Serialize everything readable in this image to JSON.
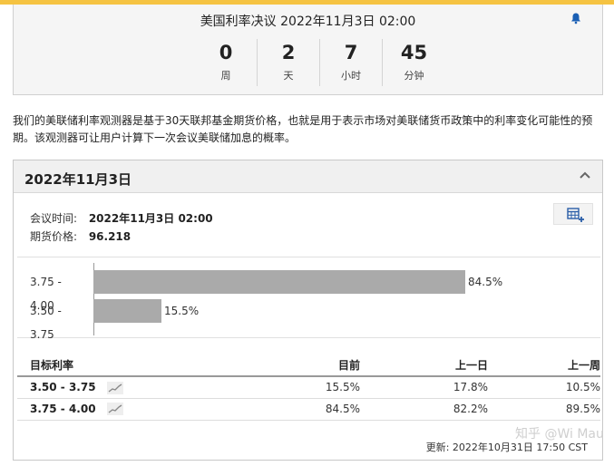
{
  "countdown": {
    "title": "美国利率决议 2022年11月3日 02:00",
    "units": [
      {
        "value": "0",
        "label": "周"
      },
      {
        "value": "2",
        "label": "天"
      },
      {
        "value": "7",
        "label": "小时"
      },
      {
        "value": "45",
        "label": "分钟"
      }
    ],
    "bell_icon": "bell-icon"
  },
  "intro": "我们的美联储利率观测器是基于30天联邦基金期货价格，也就是用于表示市场对美联储货币政策中的利率变化可能性的预期。该观测器可让用户计算下一次会议美联储加息的概率。",
  "panel": {
    "title": "2022年11月3日",
    "meeting_time_label": "会议时间:",
    "meeting_time_value": "2022年11月3日 02:00",
    "futures_price_label": "期货价格:",
    "futures_price_value": "96.218",
    "updated": "更新: 2022年10月31日 17:50 CST"
  },
  "chart_data": {
    "type": "bar",
    "orientation": "horizontal",
    "categories": [
      "3.75 - 4.00",
      "3.50 - 3.75"
    ],
    "values": [
      84.5,
      15.5
    ],
    "value_labels": [
      "84.5%",
      "15.5%"
    ],
    "xlim": [
      0,
      100
    ],
    "bar_color": "#aaaaaa"
  },
  "table": {
    "headers": [
      "目标利率",
      "目前",
      "上一日",
      "上一周"
    ],
    "rows": [
      {
        "rate": "3.50 - 3.75",
        "current": "15.5%",
        "prev_day": "17.8%",
        "prev_week": "10.5%"
      },
      {
        "rate": "3.75 - 4.00",
        "current": "84.5%",
        "prev_day": "82.2%",
        "prev_week": "89.5%"
      }
    ]
  },
  "watermark": "知乎 @Wi Mau",
  "colors": {
    "accent": "#f5c342",
    "bell": "#1a5fb4"
  }
}
